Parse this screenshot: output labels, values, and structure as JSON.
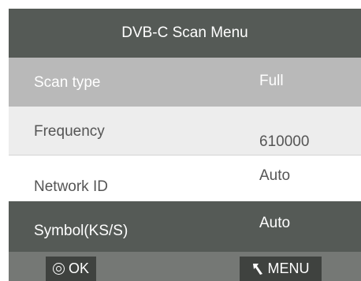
{
  "title": "DVB-C Scan Menu",
  "rows": [
    {
      "label": "Scan type",
      "value": "Full"
    },
    {
      "label": "Frequency",
      "value": "610000"
    },
    {
      "label": "Network ID",
      "value": "Auto"
    },
    {
      "label": "Symbol(KS/S)",
      "value": "Auto"
    }
  ],
  "footer": {
    "ok_label": "OK",
    "menu_label": "MENU",
    "ok_icon": "ok-circle-icon",
    "menu_icon": "back-arrow-icon"
  },
  "colors": {
    "header_bg": "#555a56",
    "selected_row_bg": "#555a56",
    "scan_row_bg": "#b9b9b9",
    "footer_bg": "#757875",
    "button_bg": "#3f423f"
  }
}
